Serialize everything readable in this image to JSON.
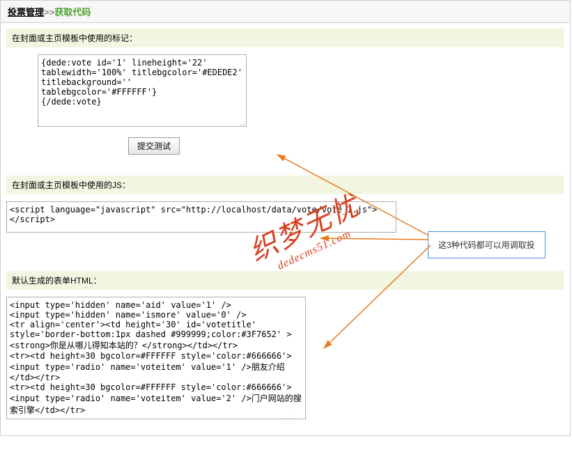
{
  "breadcrumb": {
    "link": "投票管理",
    "sep": ">>",
    "current": "获取代码"
  },
  "section1": {
    "title": "在封面或主页模板中使用的标记：",
    "content": "{dede:vote id='1' lineheight='22' \ntablewidth='100%' titlebgcolor='#EDEDE2' \ntitlebackground='' tablebgcolor='#FFFFFF'}\n{/dede:vote}"
  },
  "submit_label": "提交测试",
  "section2": {
    "title": "在封面或主页模板中使用的JS：",
    "content": "<script language=\"javascript\" src=\"http://localhost/data/vote/vote_1.js\"></script>"
  },
  "section3": {
    "title": "默认生成的表单HTML：",
    "content": "<input type='hidden' name='aid' value='1' />\n<input type='hidden' name='ismore' value='0' />\n<tr align='center'><td height='30' id='votetitle' style='border-bottom:1px dashed #999999;color:#3F7652' ><strong>你是从哪儿得知本站的？</strong></td></tr>\n<tr><td height=30 bgcolor=#FFFFFF style='color:#666666'><input type='radio' name='voteitem' value='1' />朋友介绍</td></tr>\n<tr><td height=30 bgcolor=#FFFFFF style='color:#666666'><input type='radio' name='voteitem' value='2' />门户网站的搜索引擎</td></tr>"
  },
  "annotation": "这3种代码都可以用调取投",
  "watermark": {
    "cn": "织梦无忧",
    "en": "dedecms51.com"
  }
}
